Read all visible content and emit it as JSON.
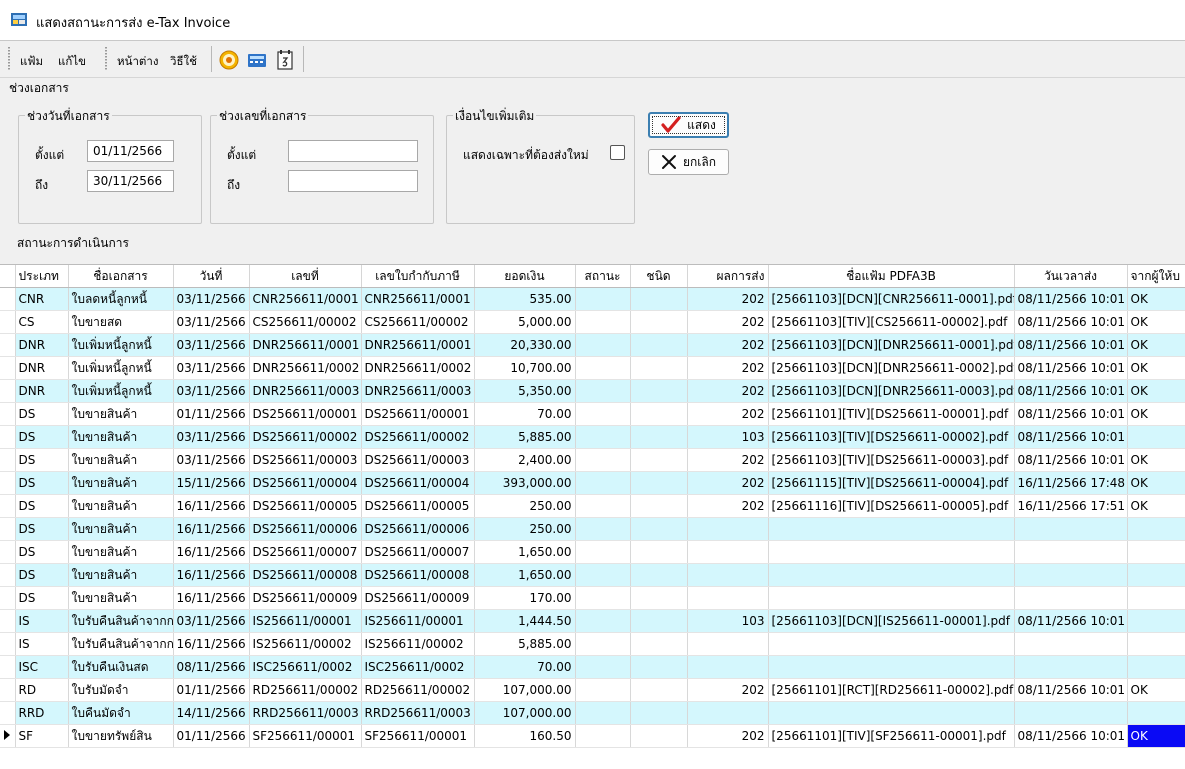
{
  "window": {
    "title": "แสดงสถานะการส่ง e-Tax Invoice"
  },
  "menu": {
    "file": "แฟ้ม",
    "edit": "แก้ไข",
    "window": "หน้าต่าง",
    "help": "วิธีใช้"
  },
  "toolbar_icons": [
    "target-icon",
    "calculator-icon",
    "calendar-icon"
  ],
  "doc_section": {
    "label": "ช่วงเอกสาร"
  },
  "date_range": {
    "legend": "ช่วงวันที่เอกสาร",
    "from_label": "ตั้งแต่",
    "from_value": "01/11/2566",
    "to_label": "ถึง",
    "to_value": "30/11/2566"
  },
  "docno_range": {
    "legend": "ช่วงเลขที่เอกสาร",
    "from_label": "ตั้งแต่",
    "from_value": "",
    "to_label": "ถึง",
    "to_value": ""
  },
  "extra": {
    "legend": "เงื่อนไขเพิ่มเติม",
    "resend_only_label": "แสดงเฉพาะที่ต้องส่งใหม่",
    "resend_only_checked": false
  },
  "buttons": {
    "show": "แสดง",
    "cancel": "ยกเลิก"
  },
  "status_label": "สถานะการดำเนินการ",
  "colors": {
    "row_alt": "#d4f7fd",
    "selection": "#0a0af5",
    "check": "#d42020"
  },
  "grid": {
    "columns": [
      "ประเภท",
      "ชื่อเอกสาร",
      "วันที่",
      "เลขที่",
      "เลขใบกำกับภาษี",
      "ยอดเงิน",
      "สถานะ",
      "ชนิด",
      "ผลการส่ง",
      "ชื่อแฟ้ม PDFA3B",
      "วันเวลาส่ง",
      "จากผู้ให้บ"
    ],
    "rows": [
      [
        "CNR",
        "ใบลดหนี้ลูกหนี้",
        "03/11/2566",
        "CNR256611/0001",
        "CNR256611/0001",
        "535.00",
        "",
        "",
        "202",
        "[25661103][DCN][CNR256611-0001].pdf",
        "08/11/2566 10:01",
        "OK"
      ],
      [
        "CS",
        "ใบขายสด",
        "03/11/2566",
        "CS256611/00002",
        "CS256611/00002",
        "5,000.00",
        "",
        "",
        "202",
        "[25661103][TIV][CS256611-00002].pdf",
        "08/11/2566 10:01",
        "OK"
      ],
      [
        "DNR",
        "ใบเพิ่มหนี้ลูกหนี้",
        "03/11/2566",
        "DNR256611/0001",
        "DNR256611/0001",
        "20,330.00",
        "",
        "",
        "202",
        "[25661103][DCN][DNR256611-0001].pdf",
        "08/11/2566 10:01",
        "OK"
      ],
      [
        "DNR",
        "ใบเพิ่มหนี้ลูกหนี้",
        "03/11/2566",
        "DNR256611/0002",
        "DNR256611/0002",
        "10,700.00",
        "",
        "",
        "202",
        "[25661103][DCN][DNR256611-0002].pdf",
        "08/11/2566 10:01",
        "OK"
      ],
      [
        "DNR",
        "ใบเพิ่มหนี้ลูกหนี้",
        "03/11/2566",
        "DNR256611/0003",
        "DNR256611/0003",
        "5,350.00",
        "",
        "",
        "202",
        "[25661103][DCN][DNR256611-0003].pdf",
        "08/11/2566 10:01",
        "OK"
      ],
      [
        "DS",
        "ใบขายสินค้า",
        "01/11/2566",
        "DS256611/00001",
        "DS256611/00001",
        "70.00",
        "",
        "",
        "202",
        "[25661101][TIV][DS256611-00001].pdf",
        "08/11/2566 10:01",
        "OK"
      ],
      [
        "DS",
        "ใบขายสินค้า",
        "03/11/2566",
        "DS256611/00002",
        "DS256611/00002",
        "5,885.00",
        "",
        "",
        "103",
        "[25661103][TIV][DS256611-00002].pdf",
        "08/11/2566 10:01",
        ""
      ],
      [
        "DS",
        "ใบขายสินค้า",
        "03/11/2566",
        "DS256611/00003",
        "DS256611/00003",
        "2,400.00",
        "",
        "",
        "202",
        "[25661103][TIV][DS256611-00003].pdf",
        "08/11/2566 10:01",
        "OK"
      ],
      [
        "DS",
        "ใบขายสินค้า",
        "15/11/2566",
        "DS256611/00004",
        "DS256611/00004",
        "393,000.00",
        "",
        "",
        "202",
        "[25661115][TIV][DS256611-00004].pdf",
        "16/11/2566 17:48",
        "OK"
      ],
      [
        "DS",
        "ใบขายสินค้า",
        "16/11/2566",
        "DS256611/00005",
        "DS256611/00005",
        "250.00",
        "",
        "",
        "202",
        "[25661116][TIV][DS256611-00005].pdf",
        "16/11/2566 17:51",
        "OK"
      ],
      [
        "DS",
        "ใบขายสินค้า",
        "16/11/2566",
        "DS256611/00006",
        "DS256611/00006",
        "250.00",
        "",
        "",
        "",
        "",
        "",
        ""
      ],
      [
        "DS",
        "ใบขายสินค้า",
        "16/11/2566",
        "DS256611/00007",
        "DS256611/00007",
        "1,650.00",
        "",
        "",
        "",
        "",
        "",
        ""
      ],
      [
        "DS",
        "ใบขายสินค้า",
        "16/11/2566",
        "DS256611/00008",
        "DS256611/00008",
        "1,650.00",
        "",
        "",
        "",
        "",
        "",
        ""
      ],
      [
        "DS",
        "ใบขายสินค้า",
        "16/11/2566",
        "DS256611/00009",
        "DS256611/00009",
        "170.00",
        "",
        "",
        "",
        "",
        "",
        ""
      ],
      [
        "IS",
        "ใบรับคืนสินค้าจากก",
        "03/11/2566",
        "IS256611/00001",
        "IS256611/00001",
        "1,444.50",
        "",
        "",
        "103",
        "[25661103][DCN][IS256611-00001].pdf",
        "08/11/2566 10:01",
        ""
      ],
      [
        "IS",
        "ใบรับคืนสินค้าจากก",
        "16/11/2566",
        "IS256611/00002",
        "IS256611/00002",
        "5,885.00",
        "",
        "",
        "",
        "",
        "",
        ""
      ],
      [
        "ISC",
        "ใบรับคืนเงินสด",
        "08/11/2566",
        "ISC256611/0002",
        "ISC256611/0002",
        "70.00",
        "",
        "",
        "",
        "",
        "",
        ""
      ],
      [
        "RD",
        "ใบรับมัดจำ",
        "01/11/2566",
        "RD256611/00002",
        "RD256611/00002",
        "107,000.00",
        "",
        "",
        "202",
        "[25661101][RCT][RD256611-00002].pdf",
        "08/11/2566 10:01",
        "OK"
      ],
      [
        "RRD",
        "ใบคืนมัดจำ",
        "14/11/2566",
        "RRD256611/0003",
        "RRD256611/0003",
        "107,000.00",
        "",
        "",
        "",
        "",
        "",
        ""
      ],
      [
        "SF",
        "ใบขายทรัพย์สิน",
        "01/11/2566",
        "SF256611/00001",
        "SF256611/00001",
        "160.50",
        "",
        "",
        "202",
        "[25661101][TIV][SF256611-00001].pdf",
        "08/11/2566 10:01",
        "OK"
      ]
    ],
    "current_row": 19
  }
}
